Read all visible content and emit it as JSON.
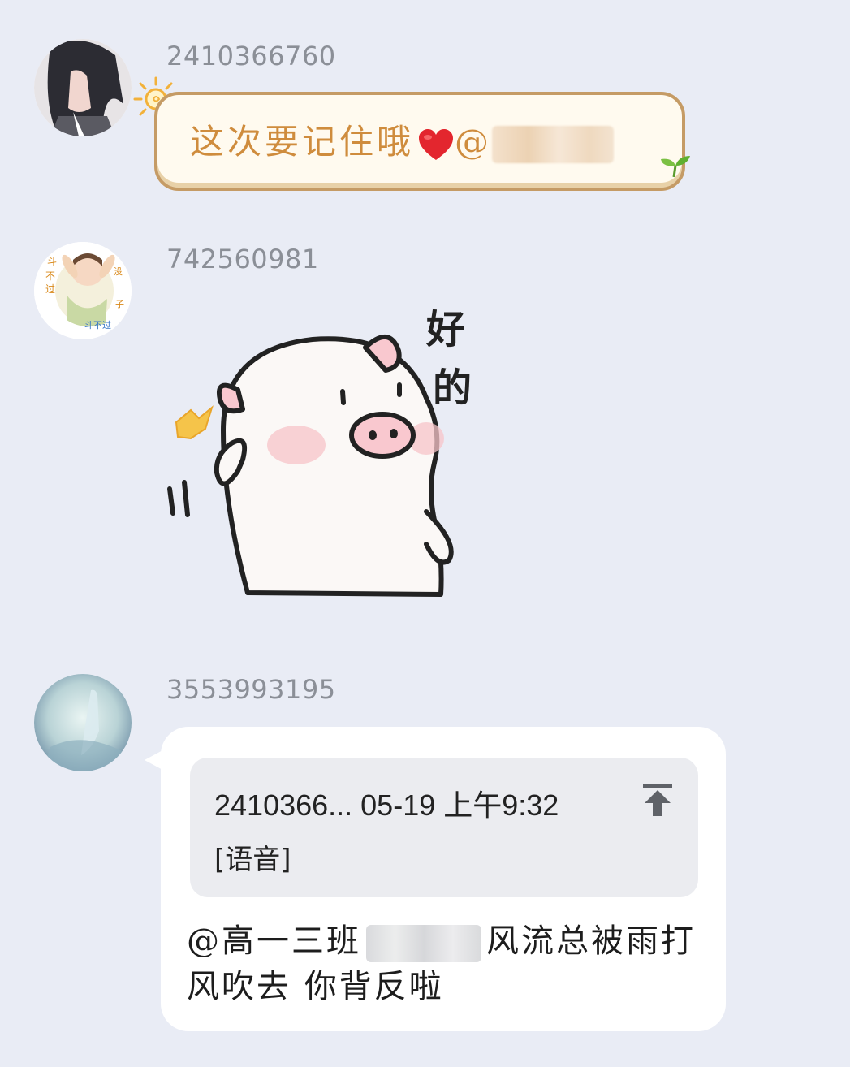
{
  "messages": [
    {
      "sender": "2410366760",
      "text": "这次要记住哦",
      "mention_prefix": "@"
    },
    {
      "sender": "742560981",
      "sticker_text": "好的"
    },
    {
      "sender": "3553993195",
      "quote": {
        "header": "2410366... 05-19 上午9:32",
        "body": "[语音]"
      },
      "reply_prefix": "@高一三班",
      "reply_suffix": "风流总被雨打风吹去 你背反啦"
    }
  ],
  "colors": {
    "background": "#e9ecf5",
    "bubble": "#ffffff",
    "quote_card": "#ebecf0",
    "deco_text": "#cf8c3d",
    "deco_border": "#c59b65",
    "sender_id": "#8b8f97"
  },
  "icons": [
    "sun-icon",
    "heart-icon",
    "leaf-icon",
    "jump-to-message-icon"
  ]
}
